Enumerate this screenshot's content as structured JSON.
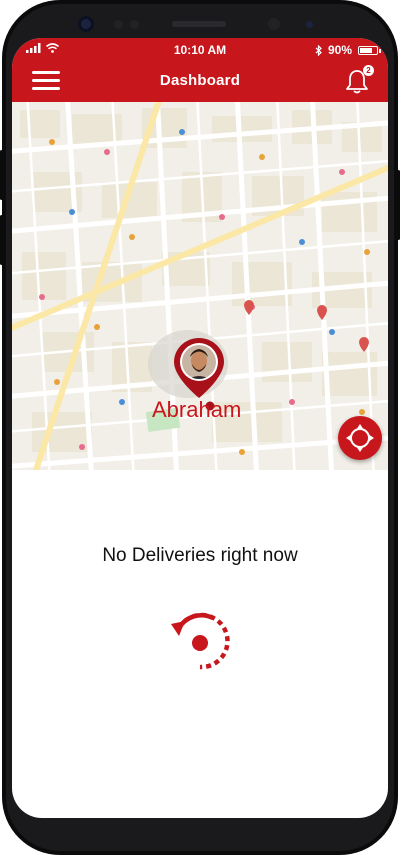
{
  "status_bar": {
    "time": "10:10 AM",
    "battery": "90%"
  },
  "header": {
    "title": "Dashboard",
    "notification_count": "2"
  },
  "map": {
    "driver_name": "Abraham"
  },
  "main": {
    "empty_message": "No Deliveries right now"
  },
  "icons": {
    "menu": "hamburger-menu-icon",
    "notifications": "bell-icon",
    "recenter": "recenter-arrows-icon",
    "refresh": "refresh-icon",
    "bluetooth": "bluetooth-icon"
  },
  "colors": {
    "brand": "#c8161d",
    "map_background": "#f2efe8",
    "text": "#111111"
  }
}
